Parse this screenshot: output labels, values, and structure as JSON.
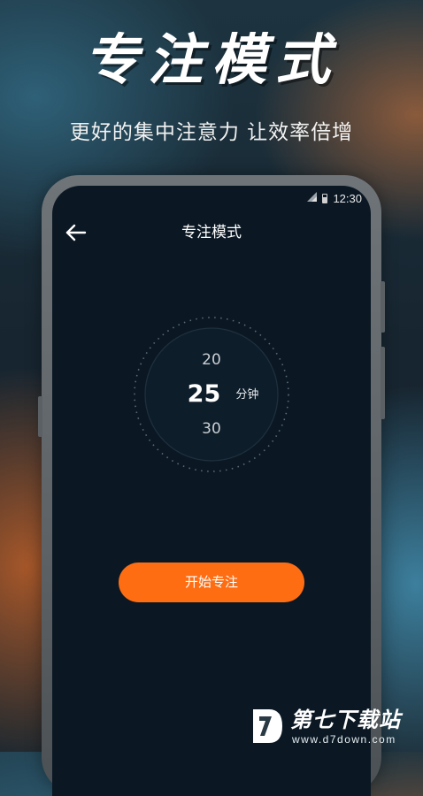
{
  "promo": {
    "headline": "专注模式",
    "subline": "更好的集中注意力 让效率倍增"
  },
  "status_bar": {
    "time": "12:30",
    "icons": [
      "signal-icon",
      "battery-icon"
    ]
  },
  "app_bar": {
    "back_icon": "arrow-left-icon",
    "title": "专注模式"
  },
  "timer_picker": {
    "previous_value": "20",
    "current_value": "25",
    "next_value": "30",
    "unit": "分钟"
  },
  "actions": {
    "start_label": "开始专注"
  },
  "watermark": {
    "title": "第七下载站",
    "url": "www.d7down.com",
    "logo_icon": "d7-logo-icon"
  },
  "colors": {
    "accent": "#ff6d12",
    "screen_background": "#0b1824",
    "text_primary": "#ffffff"
  }
}
